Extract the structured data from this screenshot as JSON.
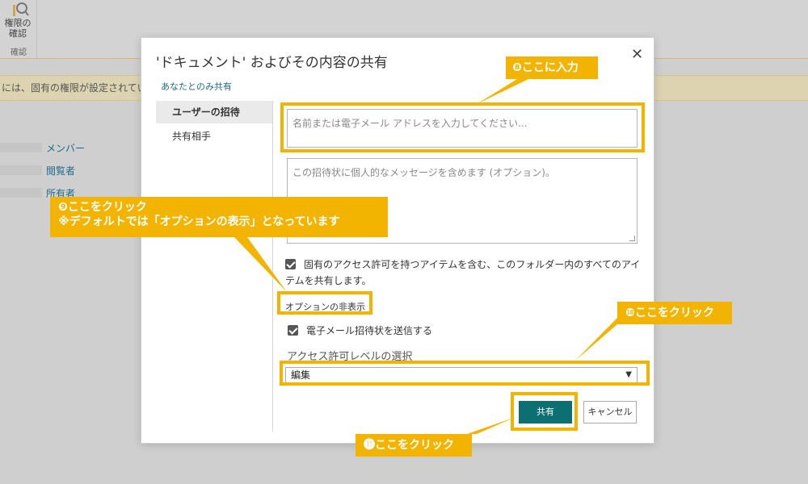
{
  "background": {
    "ribbon_label": "権限の確認",
    "ribbon_group": "確認",
    "notice_text": "には、固有の権限が設定されてい",
    "links": [
      "メンバー",
      "閲覧者",
      "所有者"
    ]
  },
  "dialog": {
    "title": "'ドキュメント' およびその内容の共有",
    "subtitle": "あなたとのみ共有",
    "nav": [
      "ユーザーの招待",
      "共有相手"
    ],
    "name_placeholder": "名前または電子メール アドレスを入力してください...",
    "message_placeholder": "この招待状に個人的なメッセージを含めます (オプション)。",
    "inherit_checkbox_label": "固有のアクセス許可を持つアイテムを含む、このフォルダー内のすべてのアイテムを共有します。",
    "options_toggle": "オプションの非表示",
    "email_checkbox_label": "電子メール招待状を送信する",
    "permission_label": "アクセス許可レベルの選択",
    "permission_selected": "編集",
    "share_button": "共有",
    "cancel_button": "キャンセル",
    "close_glyph": "✕"
  },
  "annotations": {
    "step8": "❽ここに入力",
    "step9_line1": "❾ここをクリック",
    "step9_line2": "※デフォルトでは「オプションの表示」となっています",
    "step10": "❿ここをクリック",
    "step11": "⓫ここをクリック"
  },
  "colors": {
    "accent": "#f2b400",
    "primary_button": "#0c6f72",
    "link": "#1f6a8a"
  }
}
